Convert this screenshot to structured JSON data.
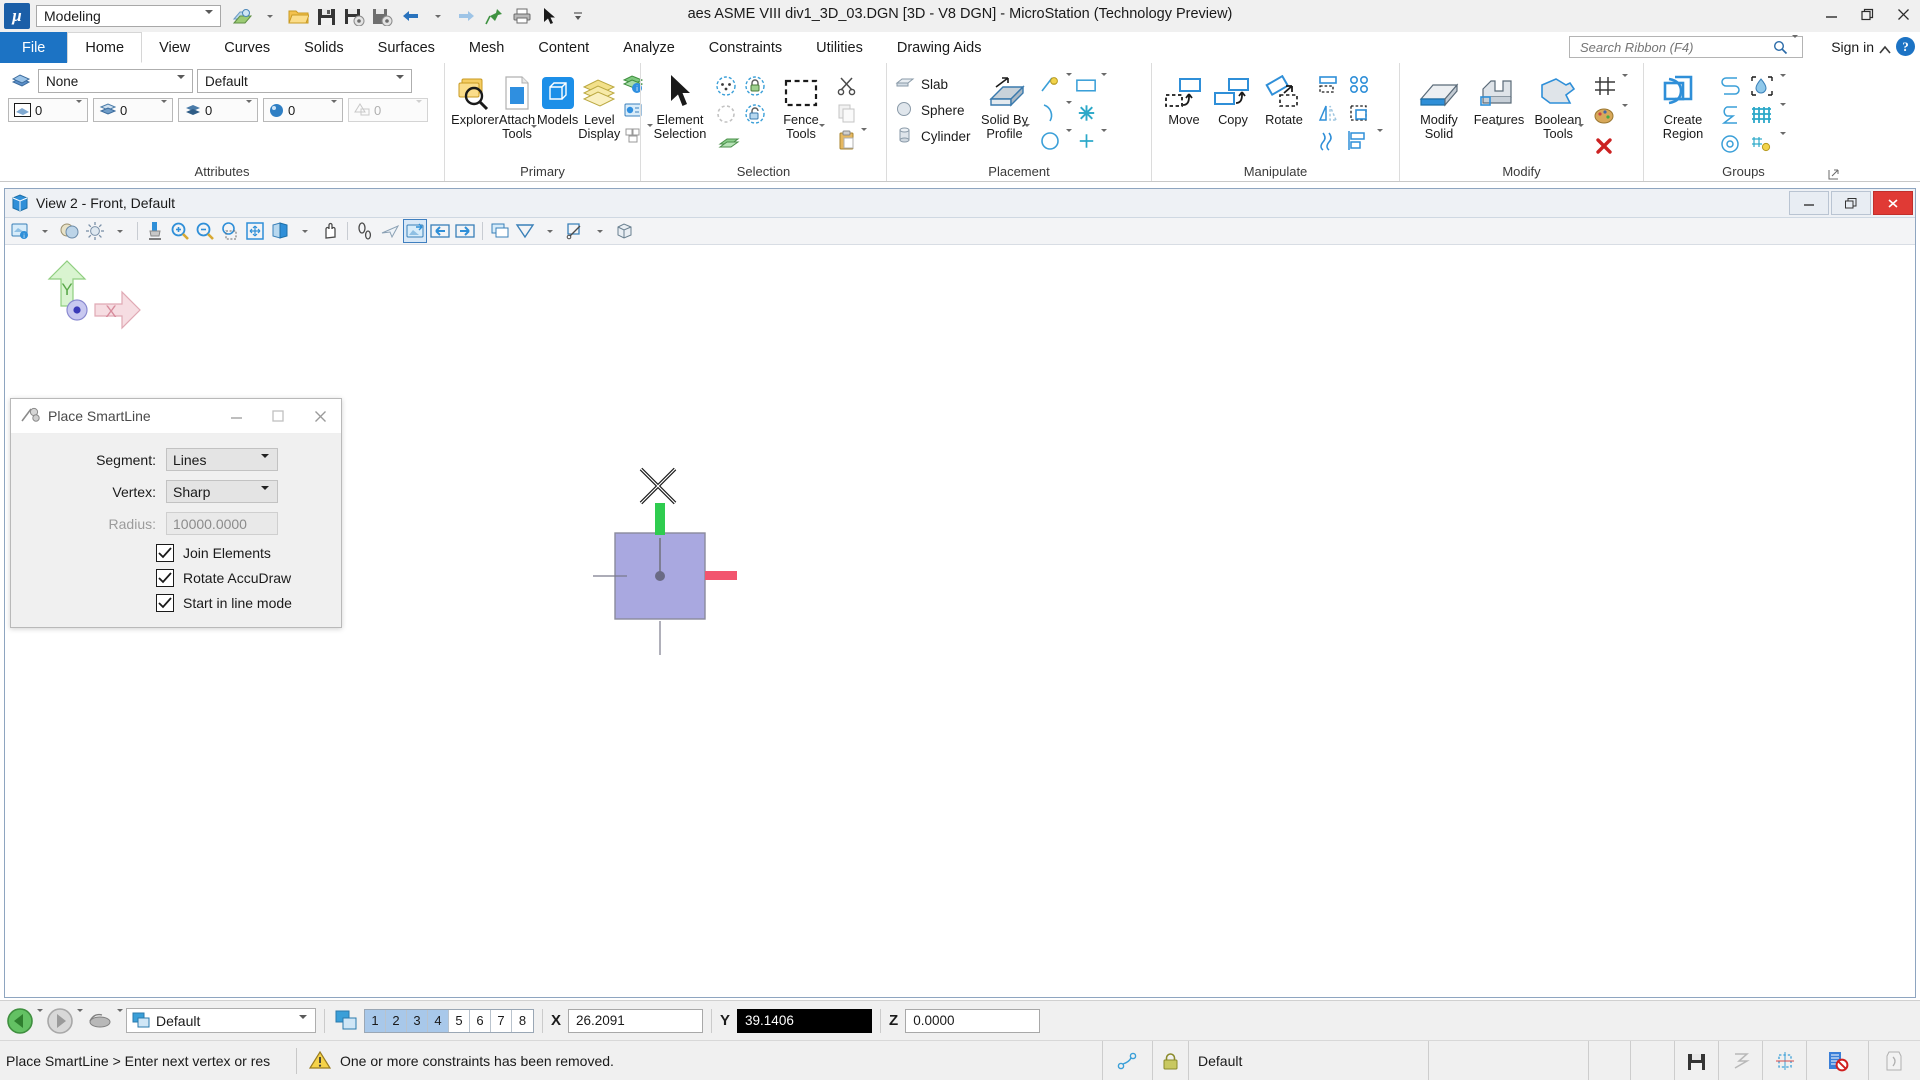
{
  "titlebar": {
    "logo": "micro-station-logo",
    "workflow": "Modeling",
    "app_title": "aes ASME VIII div1_3D_03.DGN [3D - V8 DGN] - MicroStation (Technology Preview)",
    "quick_access": [
      {
        "name": "explorer-qat-icon",
        "label": "Explorer"
      },
      {
        "name": "open-file-icon",
        "label": "Open"
      },
      {
        "name": "save-icon",
        "label": "Save"
      },
      {
        "name": "save-settings-icon",
        "label": "Save Settings"
      },
      {
        "name": "save-as-icon",
        "label": "Save As"
      },
      {
        "name": "undo-icon",
        "label": "Undo"
      },
      {
        "name": "redo-icon",
        "label": "Redo"
      },
      {
        "name": "pin-icon",
        "label": "Pin"
      },
      {
        "name": "print-icon",
        "label": "Print"
      },
      {
        "name": "select-pointer-icon",
        "label": "Select"
      },
      {
        "name": "qat-overflow-icon",
        "label": "More"
      }
    ],
    "window_buttons": {
      "minimize": "–",
      "maximize": "❐",
      "close": "✕"
    }
  },
  "tabs": [
    {
      "label": "File",
      "type": "file"
    },
    {
      "label": "Home",
      "type": "active"
    },
    {
      "label": "View",
      "type": "normal"
    },
    {
      "label": "Curves",
      "type": "normal"
    },
    {
      "label": "Solids",
      "type": "normal"
    },
    {
      "label": "Surfaces",
      "type": "normal"
    },
    {
      "label": "Mesh",
      "type": "normal"
    },
    {
      "label": "Content",
      "type": "normal"
    },
    {
      "label": "Analyze",
      "type": "normal"
    },
    {
      "label": "Constraints",
      "type": "normal"
    },
    {
      "label": "Utilities",
      "type": "normal"
    },
    {
      "label": "Drawing Aids",
      "type": "normal"
    }
  ],
  "search": {
    "placeholder": "Search Ribbon (F4)",
    "value": ""
  },
  "signin": {
    "label": "Sign in"
  },
  "ribbon": {
    "groups": [
      {
        "name": "attributes",
        "label": "Attributes",
        "level_combo": "None",
        "style_combo": "Default",
        "mini": [
          {
            "name": "color-picker",
            "value": "0"
          },
          {
            "name": "line-style-picker",
            "value": "0"
          },
          {
            "name": "line-weight-picker",
            "value": "0"
          },
          {
            "name": "transparency-picker",
            "value": "0"
          },
          {
            "name": "priority-picker",
            "value": "0",
            "disabled": true
          }
        ]
      },
      {
        "name": "primary",
        "label": "Primary",
        "buttons": [
          {
            "label": "Explorer",
            "icon": "explorer-icon"
          },
          {
            "label": "Attach\nTools",
            "icon": "attach-tools-icon",
            "dropdown": true
          },
          {
            "label": "Models",
            "icon": "models-icon",
            "active": true
          },
          {
            "label": "Level\nDisplay",
            "icon": "level-display-icon"
          }
        ],
        "small": [
          {
            "icon": "level-manager-icon"
          },
          {
            "icon": "element-info-icon"
          },
          {
            "icon": "key-in-icon",
            "dropdown": true
          }
        ]
      },
      {
        "name": "selection",
        "label": "Selection",
        "buttons": [
          {
            "label": "Element\nSelection",
            "icon": "element-selection-icon"
          },
          {
            "label": "Fence\nTools",
            "icon": "fence-icon",
            "dropdown": true
          }
        ],
        "small": [
          {
            "icon": "select-by-attributes-icon"
          },
          {
            "icon": "lock-element-icon"
          },
          {
            "icon": "select-none-icon"
          },
          {
            "icon": "unlock-element-icon"
          },
          {
            "icon": "select-all-icon"
          },
          {
            "icon": "cut-icon"
          },
          {
            "icon": "copy-icon"
          },
          {
            "icon": "paste-icon",
            "dropdown": true
          }
        ]
      },
      {
        "name": "placement",
        "label": "Placement",
        "text_items": [
          {
            "label": "Slab",
            "icon": "slab-icon"
          },
          {
            "label": "Sphere",
            "icon": "sphere-icon"
          },
          {
            "label": "Cylinder",
            "icon": "cylinder-icon"
          }
        ],
        "buttons": [
          {
            "label": "Solid By\nProfile",
            "icon": "solid-by-profile-icon",
            "dropdown": true
          }
        ],
        "small": [
          {
            "icon": "place-smartline-icon",
            "dropdown": true
          },
          {
            "icon": "place-block-icon",
            "dropdown": true
          },
          {
            "icon": "place-arc-icon",
            "dropdown": true
          },
          {
            "icon": "place-point-icon"
          },
          {
            "icon": "place-circle-icon",
            "dropdown": true
          },
          {
            "icon": "place-cross-icon",
            "dropdown": true
          }
        ]
      },
      {
        "name": "manipulate",
        "label": "Manipulate",
        "buttons": [
          {
            "label": "Move",
            "icon": "move-icon"
          },
          {
            "label": "Copy",
            "icon": "copy-element-icon"
          },
          {
            "label": "Rotate",
            "icon": "rotate-icon"
          }
        ],
        "small": [
          {
            "icon": "scale-icon"
          },
          {
            "icon": "array-icon"
          },
          {
            "icon": "mirror-icon"
          },
          {
            "icon": "construct-array-icon"
          },
          {
            "icon": "stretch-icon"
          },
          {
            "icon": "align-icon",
            "dropdown": true
          }
        ]
      },
      {
        "name": "modify",
        "label": "Modify",
        "buttons": [
          {
            "label": "Modify\nSolid",
            "icon": "modify-solid-icon"
          },
          {
            "label": "Features",
            "icon": "features-icon",
            "dropdown": true
          },
          {
            "label": "Boolean\nTools",
            "icon": "boolean-tools-icon",
            "dropdown": true
          }
        ],
        "small": [
          {
            "icon": "trim-icon",
            "dropdown": true
          },
          {
            "icon": "change-attributes-icon",
            "dropdown": true
          },
          {
            "icon": "delete-element-icon"
          }
        ]
      },
      {
        "name": "groups",
        "label": "Groups",
        "buttons": [
          {
            "label": "Create\nRegion",
            "icon": "create-region-icon"
          }
        ],
        "small": [
          {
            "icon": "create-complex-chain-icon"
          },
          {
            "icon": "flood-fill-icon",
            "dropdown": true
          },
          {
            "icon": "create-complex-shape-icon"
          },
          {
            "icon": "hatch-area-icon",
            "dropdown": true
          },
          {
            "icon": "group-hole-icon"
          },
          {
            "icon": "pattern-area-icon",
            "dropdown": true
          }
        ],
        "launcher": "dialog-launcher-icon"
      }
    ]
  },
  "view_window": {
    "title": "View 2 - Front, Default",
    "icon": "view-window-icon",
    "window_buttons": {
      "minimize": "–",
      "restore": "❐",
      "close": "✕"
    },
    "toolbar": [
      {
        "icon": "view-attributes-icon",
        "dropdown": true
      },
      {
        "icon": "display-style-icon",
        "dropdown": true
      },
      {
        "icon": "adjust-brightness-icon",
        "dropdown": true
      },
      {
        "icon": "update-view-icon"
      },
      {
        "icon": "zoom-in-icon"
      },
      {
        "icon": "zoom-out-icon"
      },
      {
        "icon": "window-area-icon"
      },
      {
        "icon": "fit-view-icon"
      },
      {
        "icon": "rotate-view-icon",
        "dropdown": true
      },
      {
        "icon": "pan-view-icon"
      },
      {
        "icon": "walk-icon"
      },
      {
        "icon": "fly-icon"
      },
      {
        "icon": "view-previous-icon",
        "selected": true
      },
      {
        "icon": "view-back-icon"
      },
      {
        "icon": "view-next-icon"
      },
      {
        "icon": "copy-view-icon"
      },
      {
        "icon": "clip-volume-icon",
        "dropdown": true
      },
      {
        "icon": "clip-mask-icon",
        "dropdown": true
      },
      {
        "icon": "view-cube-icon"
      }
    ],
    "axis_indicator": {
      "y_label": "Y",
      "x_label": "X"
    }
  },
  "dialog": {
    "title": "Place SmartLine",
    "icon": "place-smartline-dialog-icon",
    "window_buttons": {
      "minimize": "–",
      "maximize": "□",
      "close": "✕"
    },
    "fields": [
      {
        "label": "Segment:",
        "type": "select",
        "value": "Lines",
        "name": "segment-select"
      },
      {
        "label": "Vertex:",
        "type": "select",
        "value": "Sharp",
        "name": "vertex-select"
      },
      {
        "label": "Radius:",
        "type": "input",
        "value": "10000.0000",
        "name": "radius-input",
        "disabled": true
      }
    ],
    "checkboxes": [
      {
        "label": "Join Elements",
        "checked": true,
        "name": "join-elements-checkbox"
      },
      {
        "label": "Rotate AccuDraw",
        "checked": true,
        "name": "rotate-accudraw-checkbox"
      },
      {
        "label": "Start in line mode",
        "checked": true,
        "name": "start-in-line-mode-checkbox"
      }
    ]
  },
  "tool_settings_bar": {
    "nav": [
      {
        "icon": "previous-model-icon",
        "dropdown": true
      },
      {
        "icon": "next-model-icon",
        "dropdown": true
      },
      {
        "icon": "snap-mode-icon",
        "dropdown": true
      }
    ],
    "level_combo": {
      "value": "Default",
      "name": "active-level-combo"
    },
    "view_groups_icon": "view-groups-icon",
    "view_numbers": [
      {
        "n": "1",
        "on": true
      },
      {
        "n": "2",
        "on": true
      },
      {
        "n": "3",
        "on": true
      },
      {
        "n": "4",
        "on": true
      },
      {
        "n": "5",
        "on": false
      },
      {
        "n": "6",
        "on": false
      },
      {
        "n": "7",
        "on": false
      },
      {
        "n": "8",
        "on": false
      }
    ],
    "coords": [
      {
        "axis": "X",
        "value": "26.2091",
        "highlight": false,
        "name": "accudraw-x-input"
      },
      {
        "axis": "Y",
        "value": "39.1406",
        "highlight": true,
        "name": "accudraw-y-input"
      },
      {
        "axis": "Z",
        "value": "0.0000",
        "highlight": false,
        "name": "accudraw-z-input"
      }
    ]
  },
  "statusbar": {
    "prompt": "Place SmartLine > Enter next vertex or res",
    "message": "One or more constraints has been removed.",
    "warning_icon": "warning-icon",
    "snap_icon": "snap-point-icon",
    "lock_icon": "lock-icon",
    "level": "Default",
    "right_icons": [
      {
        "icon": "save-status-icon"
      },
      {
        "icon": "fence-status-icon"
      },
      {
        "icon": "snap-status-icon"
      },
      {
        "icon": "no-annotation-icon"
      },
      {
        "icon": "element-status-icon"
      }
    ]
  },
  "colors": {
    "accent_blue": "#1c73c4",
    "file_tab": "#1c73c4",
    "element_fill": "#a9a8e0",
    "element_stroke": "#8a8a9c",
    "accudraw_green": "#29c14a",
    "accudraw_red": "#e8566f",
    "close_red": "#e03a35"
  }
}
